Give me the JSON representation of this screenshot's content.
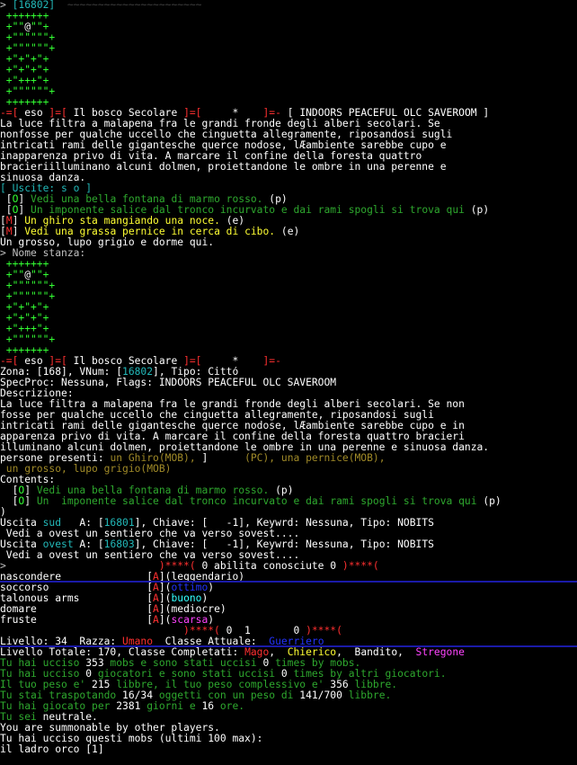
{
  "lines": [
    [
      {
        "t": "> ",
        "c": "w"
      },
      {
        "t": "[16802]",
        "c": "c"
      },
      {
        "t": "  ~~~~~~~~~~~~~~~~~~~~~~",
        "c": "ghost"
      }
    ],
    [
      {
        "t": " +++++++",
        "c": "gb"
      }
    ],
    [
      {
        "t": " +\"\"",
        "c": "gb"
      },
      {
        "t": "@",
        "c": "wb"
      },
      {
        "t": "\"\"+",
        "c": "gb"
      }
    ],
    [
      {
        "t": " +\"\"\"\"\"\"+",
        "c": "gb"
      }
    ],
    [
      {
        "t": " +\"\"\"\"\"\"+",
        "c": "gb"
      }
    ],
    [
      {
        "t": " +\"+\"+\"+",
        "c": "gb"
      }
    ],
    [
      {
        "t": " +\"+\"+\"+",
        "c": "gb"
      }
    ],
    [
      {
        "t": " +\"+++\"+",
        "c": "gb"
      }
    ],
    [
      {
        "t": " +\"\"\"\"\"\"+",
        "c": "gb"
      }
    ],
    [
      {
        "t": " +++++++",
        "c": "gb"
      }
    ],
    [
      {
        "t": "-=[ ",
        "c": "rb"
      },
      {
        "t": "eso",
        "c": "wb"
      },
      {
        "t": " ]=[ ",
        "c": "rb"
      },
      {
        "t": "Il bosco Secolare",
        "c": "wb"
      },
      {
        "t": " ]=[     ",
        "c": "rb"
      },
      {
        "t": "*",
        "c": "wb"
      },
      {
        "t": "    ]=- ",
        "c": "rb"
      },
      {
        "t": "[ INDOORS PEACEFUL OLC SAVEROOM ]",
        "c": "wb"
      }
    ],
    [
      {
        "t": "La luce filtra a malapena fra le grandi fronde degli alberi secolari. Se",
        "c": "wb"
      }
    ],
    [
      {
        "t": "nonfosse per qualche uccello che cinguetta allegramente, riposandosi sugli",
        "c": "wb"
      }
    ],
    [
      {
        "t": "intricati rami delle gigantesche querce nodose, lÆambiente sarebbe cupo e",
        "c": "wb"
      }
    ],
    [
      {
        "t": "inapparenza privo di vita. A marcare il confine della foresta quattro",
        "c": "wb"
      }
    ],
    [
      {
        "t": "bracieriilluminano alcuni dolmen, proiettandone le ombre in una perenne e",
        "c": "wb"
      }
    ],
    [
      {
        "t": "sinuosa danza.",
        "c": "wb"
      }
    ],
    [
      {
        "t": "[ Uscite: s o ]",
        "c": "c"
      }
    ],
    [
      {
        "t": " [",
        "c": "wb"
      },
      {
        "t": "O",
        "c": "gb"
      },
      {
        "t": "] ",
        "c": "wb"
      },
      {
        "t": "Vedi una bella fontana di marmo rosso. ",
        "c": "g"
      },
      {
        "t": "(p)",
        "c": "wb"
      }
    ],
    [
      {
        "t": " [",
        "c": "wb"
      },
      {
        "t": "O",
        "c": "gb"
      },
      {
        "t": "] ",
        "c": "wb"
      },
      {
        "t": "Un imponente salice dal tronco incurvato e dai rami spogli si trova qui ",
        "c": "g"
      },
      {
        "t": "(p)",
        "c": "wb"
      }
    ],
    [
      {
        "t": "[",
        "c": "wb"
      },
      {
        "t": "M",
        "c": "rb"
      },
      {
        "t": "] ",
        "c": "wb"
      },
      {
        "t": "Un ghiro sta mangiando una noce. ",
        "c": "yb"
      },
      {
        "t": "(e)",
        "c": "wb"
      }
    ],
    [
      {
        "t": "[",
        "c": "wb"
      },
      {
        "t": "M",
        "c": "rb"
      },
      {
        "t": "] ",
        "c": "wb"
      },
      {
        "t": "Vedi una grassa pernice in cerca di cibo. ",
        "c": "yb"
      },
      {
        "t": "(e)",
        "c": "wb"
      }
    ],
    [
      {
        "t": "Un grosso, lupo grigio e dorme qui.",
        "c": "wb"
      }
    ],
    [
      {
        "t": "> Nome stanza:",
        "c": "w"
      }
    ],
    [
      {
        "t": " +++++++",
        "c": "gb"
      }
    ],
    [
      {
        "t": " +\"\"",
        "c": "gb"
      },
      {
        "t": "@",
        "c": "wb"
      },
      {
        "t": "\"\"+",
        "c": "gb"
      }
    ],
    [
      {
        "t": " +\"\"\"\"\"\"+",
        "c": "gb"
      }
    ],
    [
      {
        "t": " +\"\"\"\"\"\"+",
        "c": "gb"
      }
    ],
    [
      {
        "t": " +\"+\"+\"+",
        "c": "gb"
      }
    ],
    [
      {
        "t": " +\"+\"+\"+",
        "c": "gb"
      }
    ],
    [
      {
        "t": " +\"+++\"+",
        "c": "gb"
      }
    ],
    [
      {
        "t": " +\"\"\"\"\"\"+",
        "c": "gb"
      }
    ],
    [
      {
        "t": " +++++++",
        "c": "gb"
      }
    ],
    [
      {
        "t": "-=[ ",
        "c": "rb"
      },
      {
        "t": "eso",
        "c": "wb"
      },
      {
        "t": " ]=[ ",
        "c": "rb"
      },
      {
        "t": "Il bosco Secolare",
        "c": "wb"
      },
      {
        "t": " ]=[     ",
        "c": "rb"
      },
      {
        "t": "*",
        "c": "wb"
      },
      {
        "t": "    ]=-",
        "c": "rb"
      }
    ],
    [
      {
        "t": "Zona: [168], VNum: [",
        "c": "wb"
      },
      {
        "t": "16802",
        "c": "c"
      },
      {
        "t": "], Tipo: Cittó",
        "c": "wb"
      }
    ],
    [
      {
        "t": "SpecProc: Nessuna, Flags: INDOORS PEACEFUL OLC SAVEROOM",
        "c": "wb"
      }
    ],
    [
      {
        "t": "Descrizione:",
        "c": "wb"
      }
    ],
    [
      {
        "t": "La luce filtra a malapena fra le grandi fronde degli alberi secolari. Se non",
        "c": "wb"
      }
    ],
    [
      {
        "t": "fosse per qualche uccello che cinguetta allegramente, riposandosi sugli",
        "c": "wb"
      }
    ],
    [
      {
        "t": "intricati rami delle gigantesche querce nodose, lÆambiente sarebbe cupo e in",
        "c": "wb"
      }
    ],
    [
      {
        "t": "apparenza privo di vita. A marcare il confine della foresta quattro bracieri",
        "c": "wb"
      }
    ],
    [
      {
        "t": "illuminano alcuni dolmen, proiettandone le ombre in una perenne e sinuosa danza.",
        "c": "wb"
      }
    ],
    [
      {
        "t": "persone presenti: ",
        "c": "wb"
      },
      {
        "t": "un Ghiro(MOB), ",
        "c": "ol"
      },
      {
        "t": "] ",
        "c": "wb"
      },
      {
        "t": "     (PC), una pernice(MOB),",
        "c": "ol"
      }
    ],
    [
      {
        "t": " un grosso, lupo grigio(MOB)",
        "c": "ol"
      }
    ],
    [
      {
        "t": "Contents:",
        "c": "wb"
      }
    ],
    [
      {
        "t": "  [",
        "c": "wb"
      },
      {
        "t": "O",
        "c": "gb"
      },
      {
        "t": "] ",
        "c": "wb"
      },
      {
        "t": "Vedi una bella fontana di marmo rosso. ",
        "c": "g"
      },
      {
        "t": "(p)",
        "c": "wb"
      }
    ],
    [
      {
        "t": "  [",
        "c": "wb"
      },
      {
        "t": "O",
        "c": "gb"
      },
      {
        "t": "] ",
        "c": "wb"
      },
      {
        "t": "Un  imponente salice dal tronco incurvato e dai rami spogli si trova qui ",
        "c": "g"
      },
      {
        "t": "(p)",
        "c": "wb"
      }
    ],
    [
      {
        "t": ")",
        "c": "wb"
      }
    ],
    [
      {
        "t": "Uscita ",
        "c": "wb"
      },
      {
        "t": "sud",
        "c": "c"
      },
      {
        "t": "   A: [",
        "c": "wb"
      },
      {
        "t": "16801",
        "c": "c"
      },
      {
        "t": "], Chiave: [   -1], Keywrd: Nessuna, Tipo: NOBITS",
        "c": "wb"
      }
    ],
    [
      {
        "t": " Vedi a ovest un sentiero che va verso sovest....",
        "c": "wb"
      }
    ],
    [
      {
        "t": "Uscita ",
        "c": "wb"
      },
      {
        "t": "ovest",
        "c": "c"
      },
      {
        "t": " A: [",
        "c": "wb"
      },
      {
        "t": "16803",
        "c": "c"
      },
      {
        "t": "], Chiave: [   -1], Keywrd: Nessuna, Tipo: NOBITS",
        "c": "wb"
      }
    ],
    [
      {
        "t": " Vedi a ovest un sentiero che va verso sovest....",
        "c": "wb"
      }
    ],
    [
      {
        "t": "> ",
        "c": "w"
      },
      {
        "t": "                        ",
        "c": "bl"
      },
      {
        "t": ")****( ",
        "c": "rb"
      },
      {
        "t": "0 abilita conosciute 0",
        "c": "wb"
      },
      {
        "t": " )****(",
        "c": "rb"
      }
    ],
    [
      {
        "t": "nascondere              [",
        "c": "wb"
      },
      {
        "t": "A",
        "c": "rb"
      },
      {
        "t": "](leggendario)",
        "c": "wb"
      }
    ],
    [
      {
        "t": "soccorso                [",
        "c": "wb"
      },
      {
        "t": "A",
        "c": "rb"
      },
      {
        "t": "](",
        "c": "wb"
      },
      {
        "t": "ottimo",
        "c": "bl"
      },
      {
        "t": ")",
        "c": "wb"
      }
    ],
    [
      {
        "t": "talonous arms           [",
        "c": "wb"
      },
      {
        "t": "A",
        "c": "rb"
      },
      {
        "t": "](",
        "c": "wb"
      },
      {
        "t": "buono",
        "c": "cb"
      },
      {
        "t": ")",
        "c": "wb"
      }
    ],
    [
      {
        "t": "domare                  [",
        "c": "wb"
      },
      {
        "t": "A",
        "c": "rb"
      },
      {
        "t": "](mediocre)",
        "c": "wb"
      }
    ],
    [
      {
        "t": "fruste                  [",
        "c": "wb"
      },
      {
        "t": "A",
        "c": "rb"
      },
      {
        "t": "](",
        "c": "wb"
      },
      {
        "t": "scarsa",
        "c": "m"
      },
      {
        "t": ")",
        "c": "wb"
      }
    ],
    [
      {
        "t": "                              ",
        "c": "bl"
      },
      {
        "t": ")****( ",
        "c": "rb"
      },
      {
        "t": "0  1       0",
        "c": "wb"
      },
      {
        "t": " )****(",
        "c": "rb"
      }
    ],
    [
      {
        "t": "Livello: 34  Razza: ",
        "c": "wb"
      },
      {
        "t": "Umano",
        "c": "rb"
      },
      {
        "t": "  Classe Attuale:  ",
        "c": "wb"
      },
      {
        "t": "Guerriero",
        "c": "bl"
      }
    ],
    [
      {
        "t": "Livello Totale: 170, Classe Completati: ",
        "c": "wb"
      },
      {
        "t": "Mago",
        "c": "rb"
      },
      {
        "t": ",  ",
        "c": "wb"
      },
      {
        "t": "Chierico",
        "c": "yb"
      },
      {
        "t": ",  Bandito,  ",
        "c": "wb"
      },
      {
        "t": "Stregone",
        "c": "m"
      }
    ],
    [
      {
        "t": "Tu hai ucciso ",
        "c": "g"
      },
      {
        "t": "353",
        "c": "wb"
      },
      {
        "t": " mobs e sono stati uccisi ",
        "c": "g"
      },
      {
        "t": "0",
        "c": "wb"
      },
      {
        "t": " times by mobs.",
        "c": "g"
      }
    ],
    [
      {
        "t": "Tu hai ucciso ",
        "c": "g"
      },
      {
        "t": "0",
        "c": "wb"
      },
      {
        "t": " giocatori e sono stati uccisi ",
        "c": "g"
      },
      {
        "t": "0",
        "c": "wb"
      },
      {
        "t": " times by altri giocatori.",
        "c": "g"
      }
    ],
    [
      {
        "t": "Il tuo peso e' ",
        "c": "g"
      },
      {
        "t": "215",
        "c": "wb"
      },
      {
        "t": " libbre, il tuo peso complessivo e' ",
        "c": "g"
      },
      {
        "t": "356",
        "c": "wb"
      },
      {
        "t": " libbre.",
        "c": "g"
      }
    ],
    [
      {
        "t": "Tu stai traspotando ",
        "c": "g"
      },
      {
        "t": "16/34",
        "c": "wb"
      },
      {
        "t": " oggetti con un peso di ",
        "c": "g"
      },
      {
        "t": "141/700",
        "c": "wb"
      },
      {
        "t": " libbre.",
        "c": "g"
      }
    ],
    [
      {
        "t": "Tu hai giocato per ",
        "c": "g"
      },
      {
        "t": "2381",
        "c": "wb"
      },
      {
        "t": " giorni e ",
        "c": "g"
      },
      {
        "t": "16",
        "c": "wb"
      },
      {
        "t": " ore.",
        "c": "g"
      }
    ],
    [
      {
        "t": "Tu sei ",
        "c": "g"
      },
      {
        "t": "neutrale.",
        "c": "wb"
      }
    ],
    [
      {
        "t": "You are summonable by other players.",
        "c": "wb"
      }
    ],
    [
      {
        "t": "Tu hai ucciso questi mobs (ultimi 100 max):",
        "c": "wb"
      }
    ],
    [
      {
        "t": "il ladro orco [1]",
        "c": "wb"
      }
    ]
  ],
  "colors": {
    "background": "#000000",
    "text": "#c0c0c0",
    "bright_white": "#ffffff",
    "green": "#2ea82e",
    "bright_green": "#33ff33",
    "yellow": "#ffff33",
    "cyan": "#22b8b8",
    "red": "#ff3030",
    "blue": "#2233ff",
    "magenta": "#ff44ff",
    "olive": "#a08a28"
  }
}
